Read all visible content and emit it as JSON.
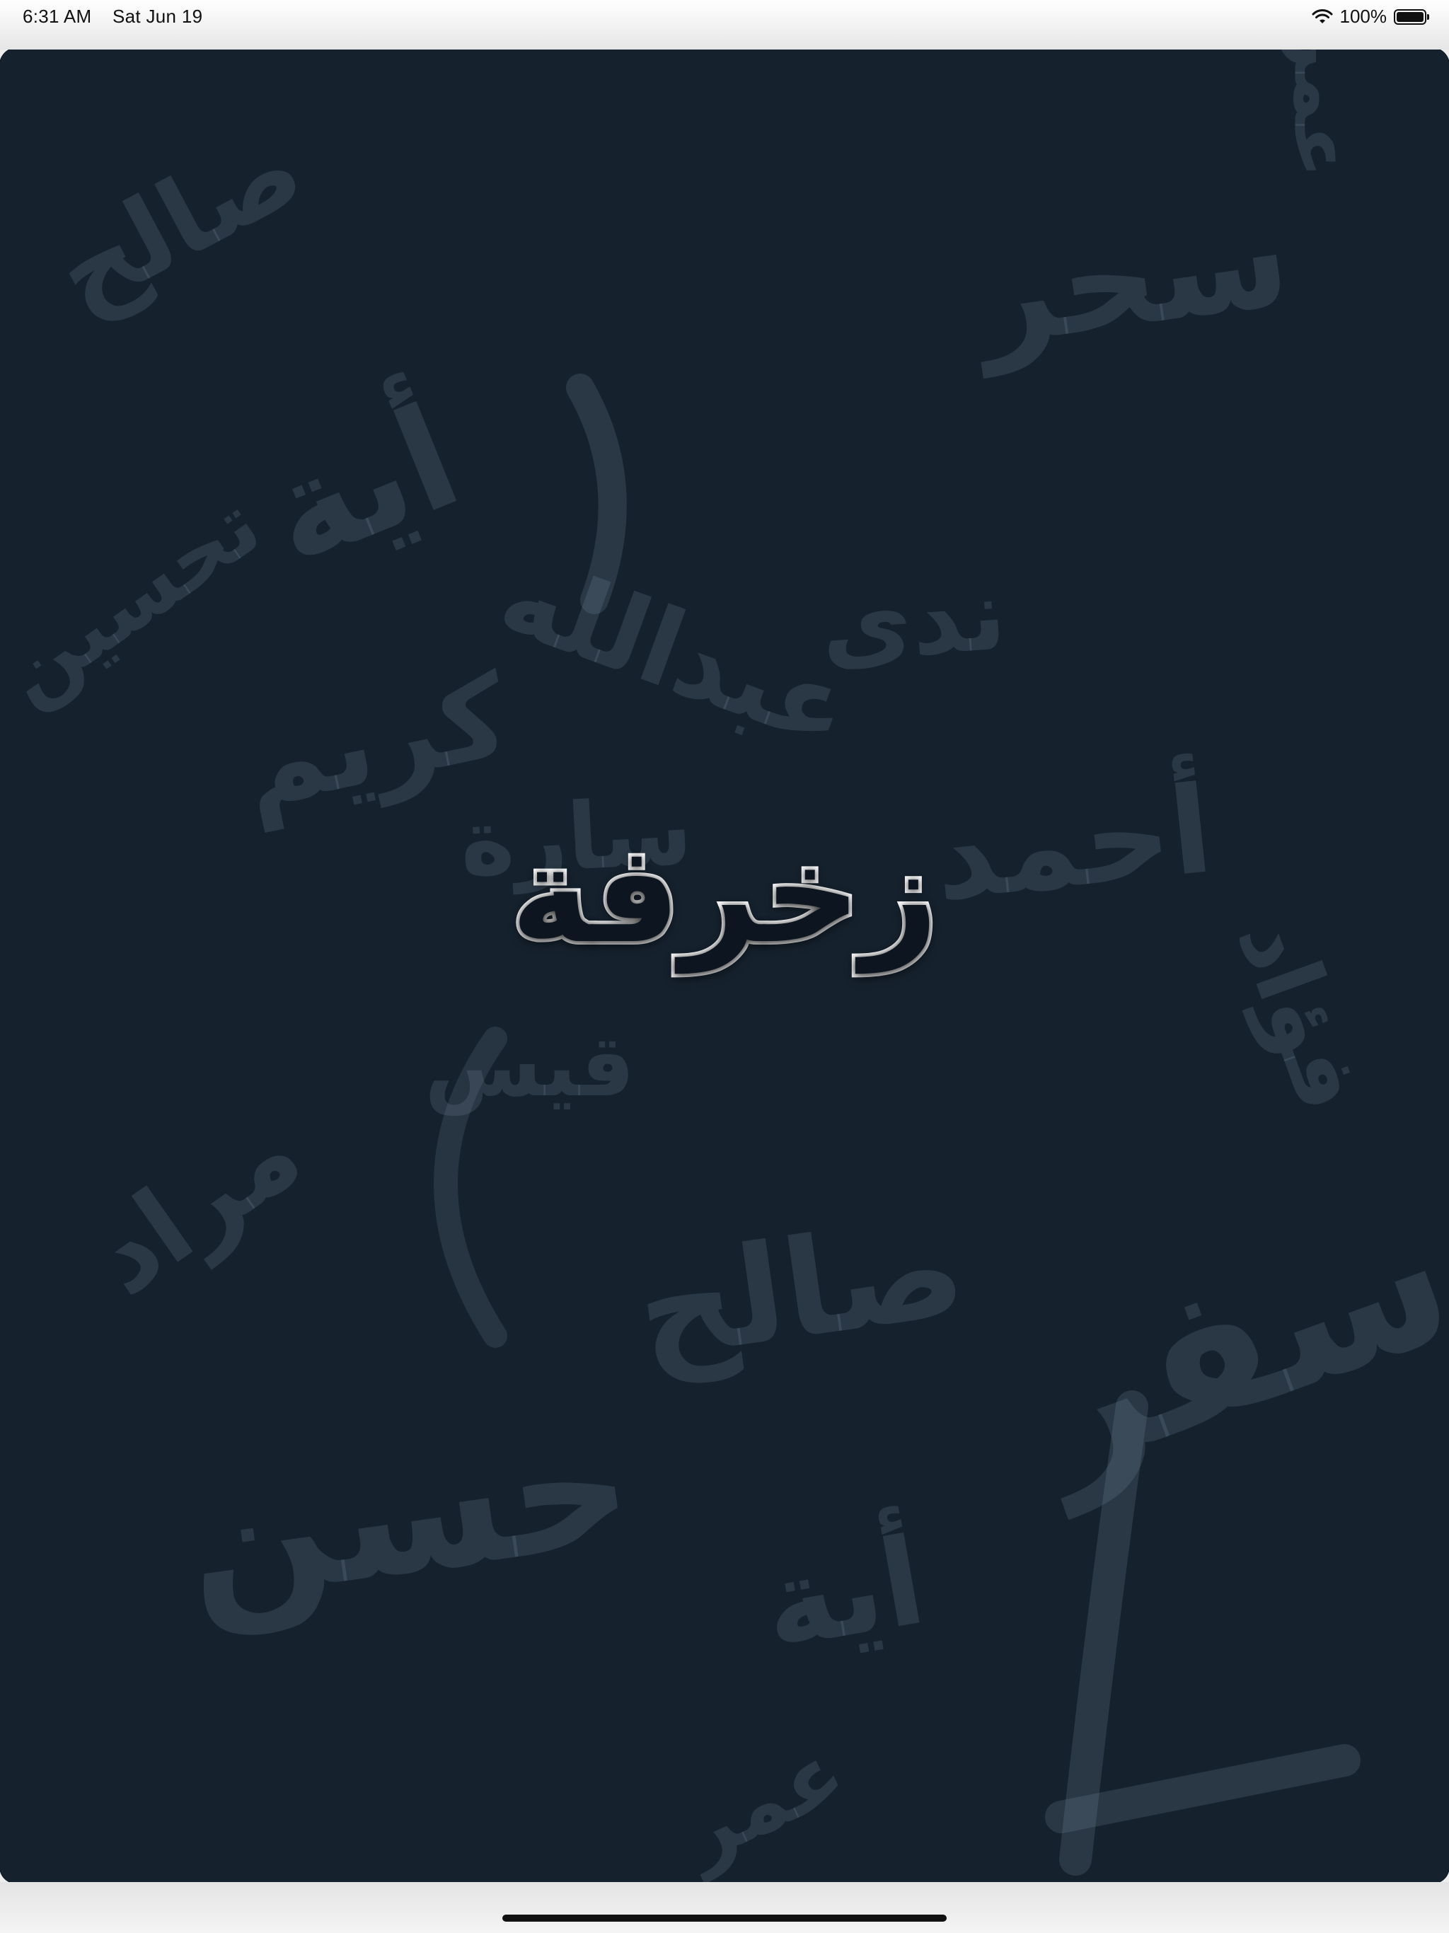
{
  "status_bar": {
    "time": "6:31 AM",
    "date": "Sat Jun 19",
    "battery_percent": "100%",
    "wifi_icon": "wifi-icon",
    "battery_icon": "battery-full-icon"
  },
  "app": {
    "logo_text": "زخرفة"
  },
  "background_words": [
    "صالح",
    "عمر",
    "سحر",
    "أية",
    "تحسين",
    "كريم",
    "ندى",
    "عبدالله",
    "سارة",
    "أحمد",
    "قيس",
    "مراد",
    "حسن",
    "صالح",
    "سفر",
    "عمر",
    "أية",
    "فؤاد"
  ],
  "colors": {
    "background": "#15212d",
    "logo_fill": "#0d1620",
    "logo_outline": "#ffffff"
  }
}
